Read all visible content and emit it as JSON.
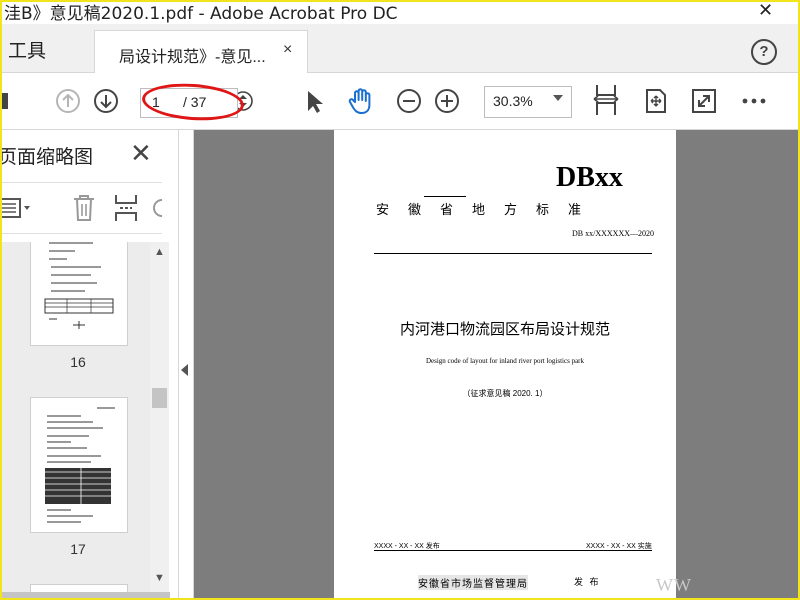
{
  "window": {
    "title": "洼B》意见稿2020.1.pdf - Adobe Acrobat Pro DC"
  },
  "tabs": {
    "tools_label": "工具",
    "doc_label": "局设计规范》-意见...",
    "close_symbol": "×"
  },
  "toolbar": {
    "current_page": "1",
    "total_pages": "/ 37",
    "zoom": "30.3%"
  },
  "sidepanel": {
    "title": "页面缩略图",
    "thumbnails": [
      {
        "label": "16"
      },
      {
        "label": "17"
      }
    ]
  },
  "document": {
    "standard_code": "DBxx",
    "province_standard": "安徽省地方标准",
    "doc_number": "DB xx/XXXXXX—2020",
    "title_cn": "内河港口物流园区布局设计规范",
    "title_en": "Design code of layout for inland river port logistics park",
    "draft_note": "（征求意见稿 2020. 1）",
    "publish_date": "XXXX - XX - XX 发布",
    "implement_date": "XXXX - XX - XX 实施",
    "authority": "安徽省市场监督管理局",
    "issue_label": "发 布"
  },
  "colors": {
    "hand_tool": "#1a6fd1",
    "highlight_oval": "#e01515",
    "frame_border": "#f2e41a"
  }
}
